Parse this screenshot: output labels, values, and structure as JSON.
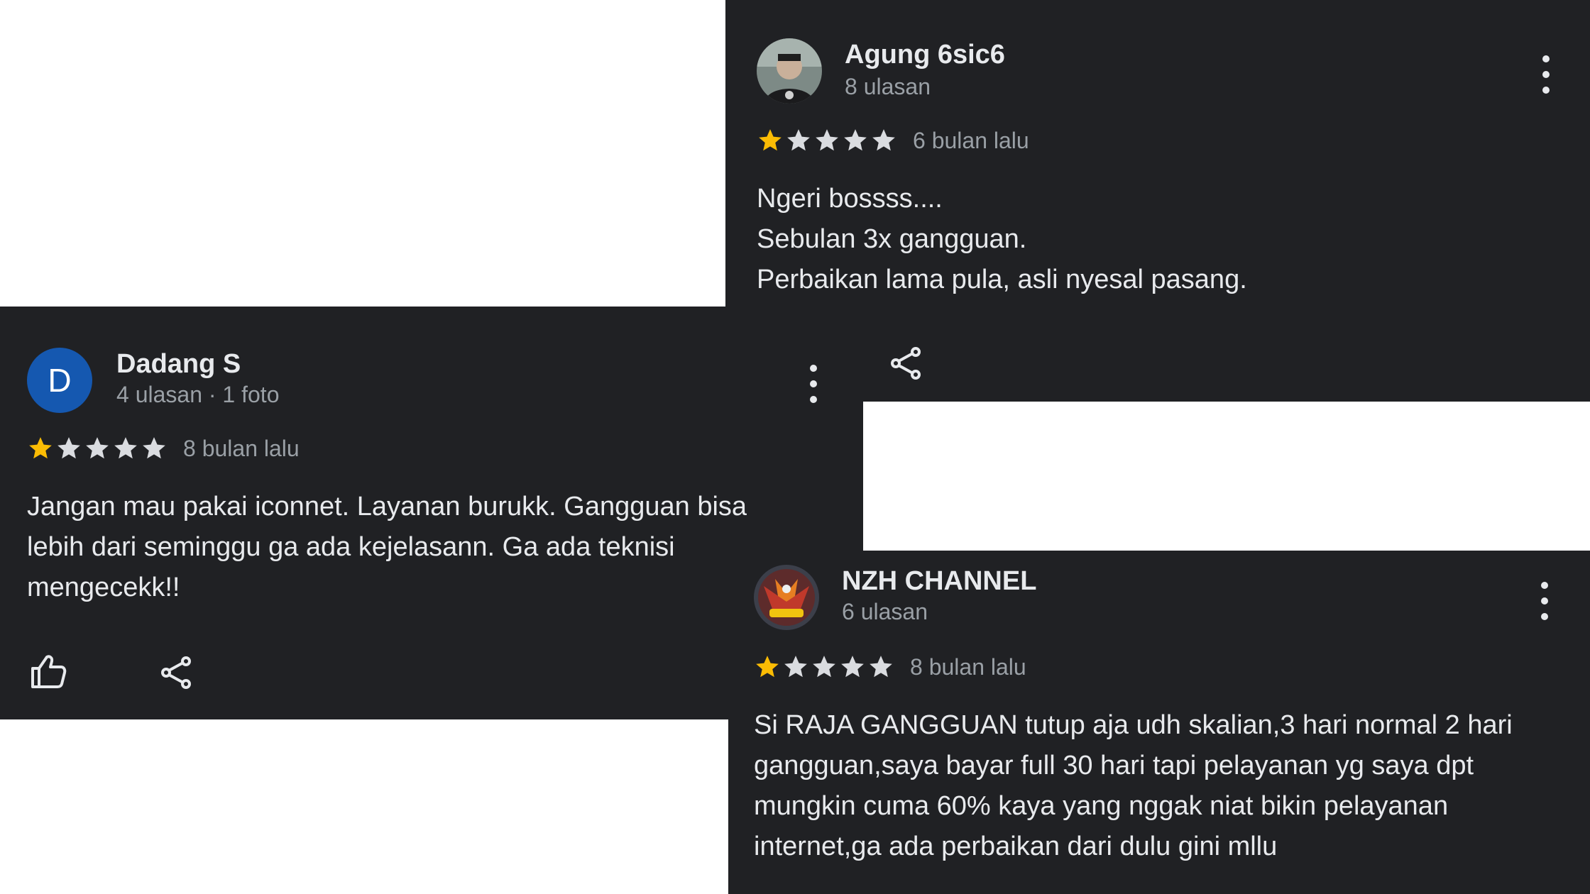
{
  "reviews": [
    {
      "id": "agung",
      "name": "Agung 6sic6",
      "meta": "8 ulasan",
      "rating": 1,
      "max_rating": 5,
      "date": "6 bulan lalu",
      "text_lines": [
        "Ngeri bossss....",
        "Sebulan 3x gangguan.",
        "Perbaikan lama pula, asli nyesal pasang."
      ],
      "avatar": "photo"
    },
    {
      "id": "dadang",
      "name": "Dadang S",
      "meta": "4 ulasan · 1 foto",
      "rating": 1,
      "max_rating": 5,
      "date": "8 bulan lalu",
      "text_lines": [
        "Jangan mau pakai iconnet. Layanan burukk. Gangguan bisa",
        "lebih dari seminggu ga ada kejelasann. Ga ada teknisi",
        "mengecekk!!"
      ],
      "avatar": "letter",
      "avatar_letter": "D"
    },
    {
      "id": "nzh",
      "name": "NZH CHANNEL",
      "meta": "6 ulasan",
      "rating": 1,
      "max_rating": 5,
      "date": "8 bulan lalu",
      "text_lines": [
        "Si RAJA GANGGUAN tutup aja udh skalian,3 hari normal 2 hari",
        "gangguan,saya bayar full 30 hari tapi pelayanan yg saya dpt",
        "mungkin cuma 60% kaya yang nggak niat bikin pelayanan",
        "internet,ga ada perbaikan dari dulu gini mllu"
      ],
      "avatar": "photo"
    }
  ],
  "colors": {
    "card_bg": "#202124",
    "star_filled": "#fbbc04",
    "star_empty": "#dadce0",
    "avatar_letter_bg": "#1558b0"
  },
  "icons": {
    "like": "thumbs-up-icon",
    "share": "share-icon",
    "more": "more-vert-icon",
    "star": "star-icon"
  }
}
